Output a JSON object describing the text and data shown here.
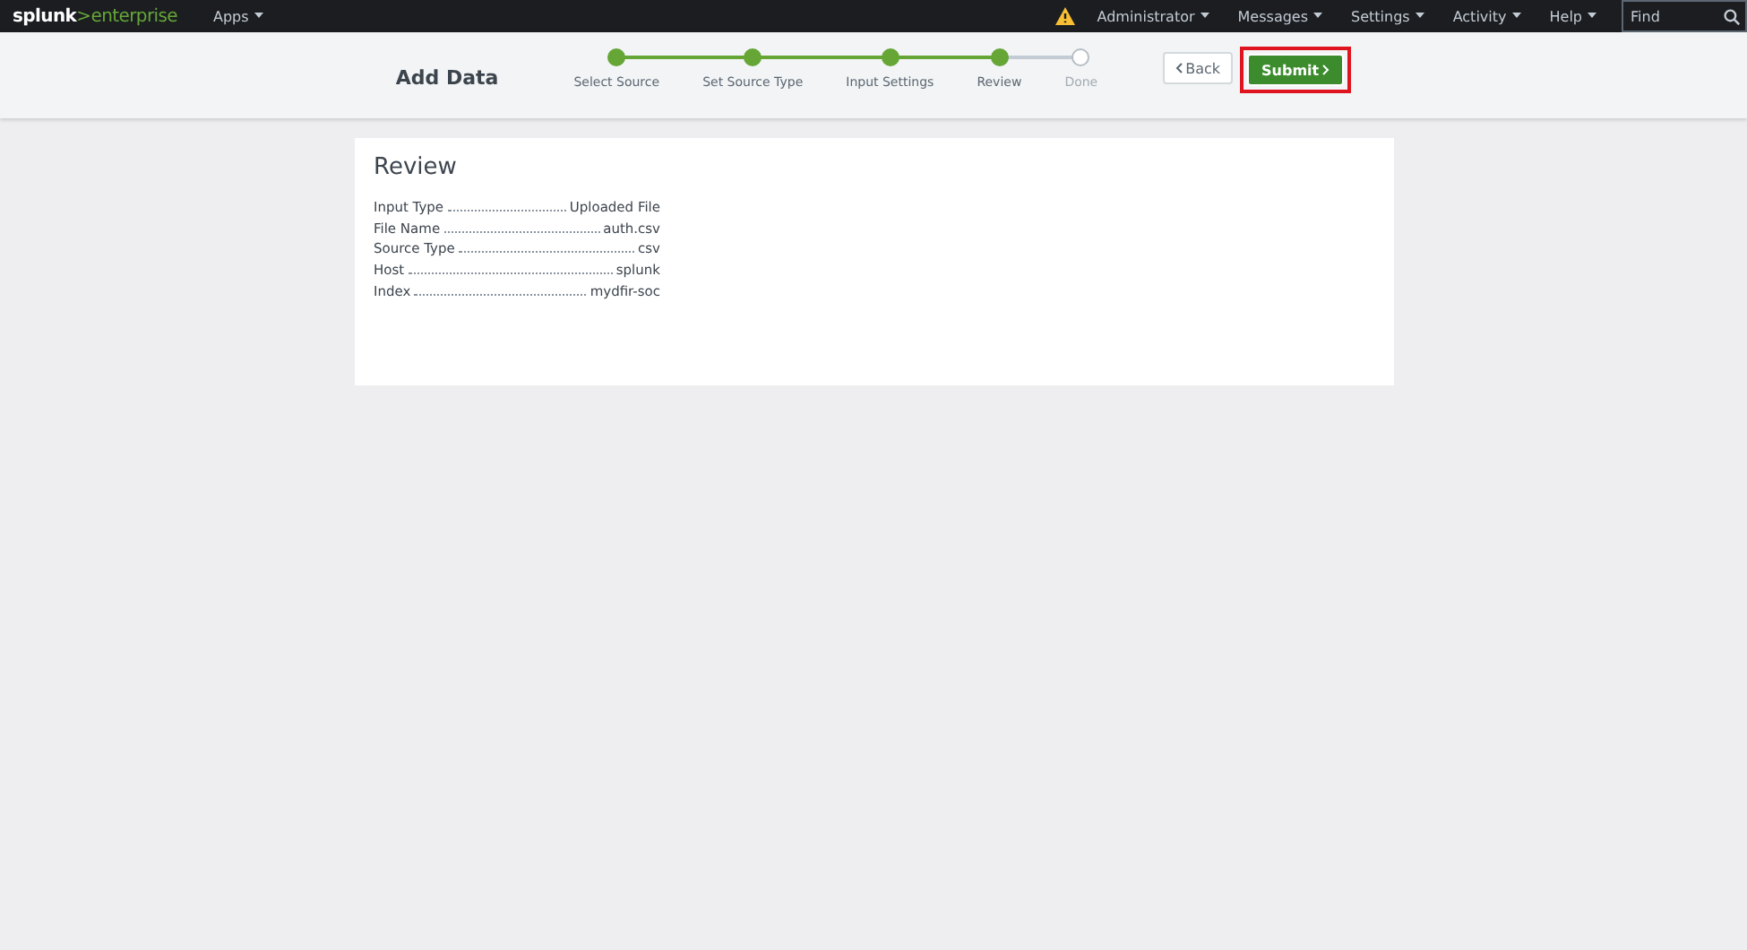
{
  "topbar": {
    "logo": {
      "brand": "splunk",
      "product": ">enterprise"
    },
    "apps_menu": "Apps",
    "warning": true,
    "menus": [
      "Administrator",
      "Messages",
      "Settings",
      "Activity",
      "Help"
    ],
    "search": {
      "placeholder": "Find"
    }
  },
  "wizard": {
    "title": "Add Data",
    "steps": [
      {
        "label": "Select Source",
        "done": true
      },
      {
        "label": "Set Source Type",
        "done": true
      },
      {
        "label": "Input Settings",
        "done": true
      },
      {
        "label": "Review",
        "done": true
      },
      {
        "label": "Done",
        "done": false
      }
    ],
    "back_button": "Back",
    "submit_button": {
      "label": "Submit",
      "highlighted": true
    }
  },
  "review": {
    "title": "Review",
    "rows": [
      {
        "label": "Input Type",
        "value": "Uploaded File"
      },
      {
        "label": "File Name",
        "value": "auth.csv"
      },
      {
        "label": "Source Type",
        "value": "csv"
      },
      {
        "label": "Host",
        "value": "splunk"
      },
      {
        "label": "Index",
        "value": "mydfir-soc"
      }
    ]
  }
}
